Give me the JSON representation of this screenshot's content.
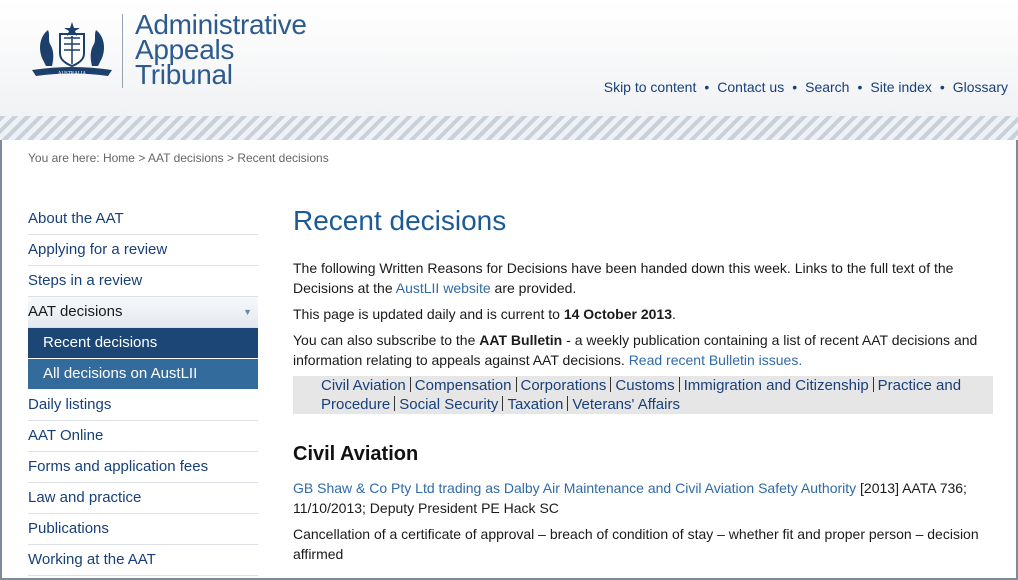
{
  "header": {
    "agency_line1": "Administrative",
    "agency_line2": "Appeals",
    "agency_line3": "Tribunal",
    "crest_text": "AUSTRALIA",
    "links": [
      "Skip to content",
      "Contact us",
      "Search",
      "Site index",
      "Glossary"
    ]
  },
  "breadcrumb": {
    "prefix": "You are here:",
    "items": [
      "Home",
      "AAT decisions",
      "Recent decisions"
    ],
    "sep": ">"
  },
  "sidebar": {
    "items": [
      "About the AAT",
      "Applying for a review",
      "Steps in a review",
      "AAT decisions",
      "Recent decisions",
      "All decisions on AustLII",
      "Daily listings",
      "AAT Online",
      "Forms and application fees",
      "Law and practice",
      "Publications",
      "Working at the AAT"
    ]
  },
  "main": {
    "title": "Recent decisions",
    "intro_1": "The following Written Reasons for Decisions have been handed down this week. Links to the full text of the Decisions at the ",
    "intro_link": "AustLII website",
    "intro_2": " are provided.",
    "updated_1": "This page is updated daily and is current to ",
    "updated_date": "14 October 2013",
    "updated_2": ".",
    "bulletin_1": "You can also subscribe to the ",
    "bulletin_name": "AAT Bulletin",
    "bulletin_2": " - a weekly publication containing a list of recent AAT decisions and information relating to appeals against AAT decisions. ",
    "bulletin_link": "Read recent Bulletin issues.",
    "categories": [
      "Civil Aviation",
      "Compensation",
      "Corporations",
      "Customs",
      "Immigration and Citizenship",
      "Practice and Procedure",
      "Social Security",
      "Taxation",
      "Veterans' Affairs"
    ],
    "section_title": "Civil Aviation",
    "case_link": "GB Shaw & Co Pty Ltd trading as Dalby Air Maintenance and Civil Aviation Safety Authority",
    "case_citation": " [2013] AATA 736; 11/10/2013; Deputy President PE Hack SC",
    "case_summary": "Cancellation of a certificate of approval – breach of condition of stay – whether fit and proper person – decision affirmed"
  }
}
